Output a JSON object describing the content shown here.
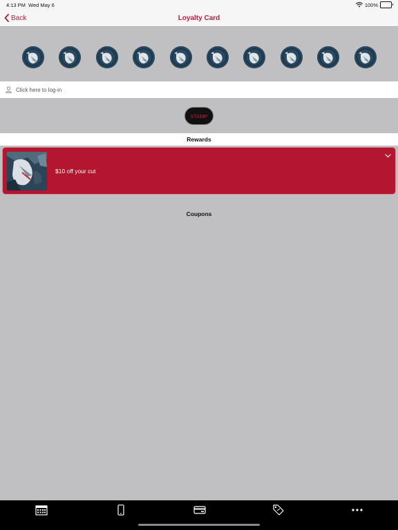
{
  "status_bar": {
    "time": "4:13 PM",
    "date": "Wed May 6",
    "battery": "100%"
  },
  "nav": {
    "back_label": "Back",
    "title": "Loyalty Card"
  },
  "stamps": {
    "count": 10,
    "icon": "logo-stamp-icon"
  },
  "login": {
    "label": "Click here to log-in"
  },
  "stamp_button": {
    "label": "STAMP"
  },
  "rewards": {
    "header": "Rewards",
    "items": [
      {
        "label": "$10 off your cut"
      }
    ]
  },
  "coupons": {
    "header": "Coupons"
  },
  "tab_bar": {
    "items": [
      {
        "icon": "calendar-icon"
      },
      {
        "icon": "phone-icon"
      },
      {
        "icon": "card-icon"
      },
      {
        "icon": "tag-icon"
      },
      {
        "icon": "more-icon"
      }
    ]
  },
  "colors": {
    "accent": "#b3213d",
    "reward_bg": "#b3162f",
    "background": "#c0bfc1"
  }
}
